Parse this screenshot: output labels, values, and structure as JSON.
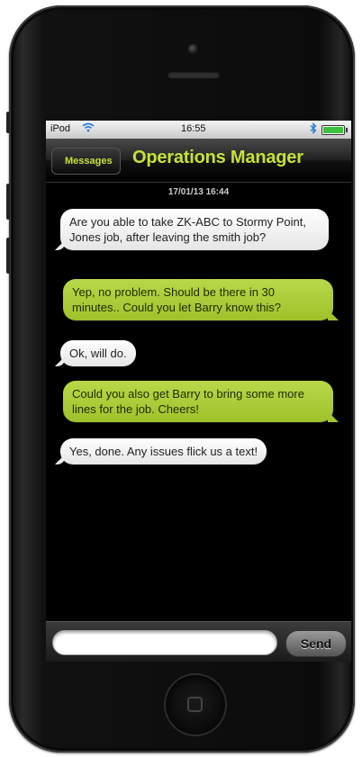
{
  "status_bar": {
    "carrier": "iPod",
    "time": "16:55"
  },
  "nav": {
    "back_label": "Messages",
    "title": "Operations Manager"
  },
  "conversation": {
    "timestamp": "17/01/13 16:44",
    "messages": [
      {
        "direction": "in",
        "text": "Are you able to take ZK-ABC to Stormy Point, Jones job, after leaving the smith job?"
      },
      {
        "direction": "out",
        "text": "Yep, no problem. Should be there in 30 minutes.. Could you let Barry know this?"
      },
      {
        "direction": "in",
        "text": "Ok, will do."
      },
      {
        "direction": "out",
        "text": "Could you also get Barry to bring some more lines for the job. Cheers!"
      },
      {
        "direction": "in",
        "text": "Yes, done. Any issues flick us a text!"
      }
    ]
  },
  "compose": {
    "value": "",
    "send_label": "Send"
  },
  "colors": {
    "accent": "#c3e23a",
    "outgoing_bubble": "#a8c935",
    "incoming_bubble": "#f2f2f2"
  },
  "icons": [
    "wifi-icon",
    "bluetooth-icon",
    "battery-icon",
    "back-chevron-icon",
    "home-icon"
  ]
}
